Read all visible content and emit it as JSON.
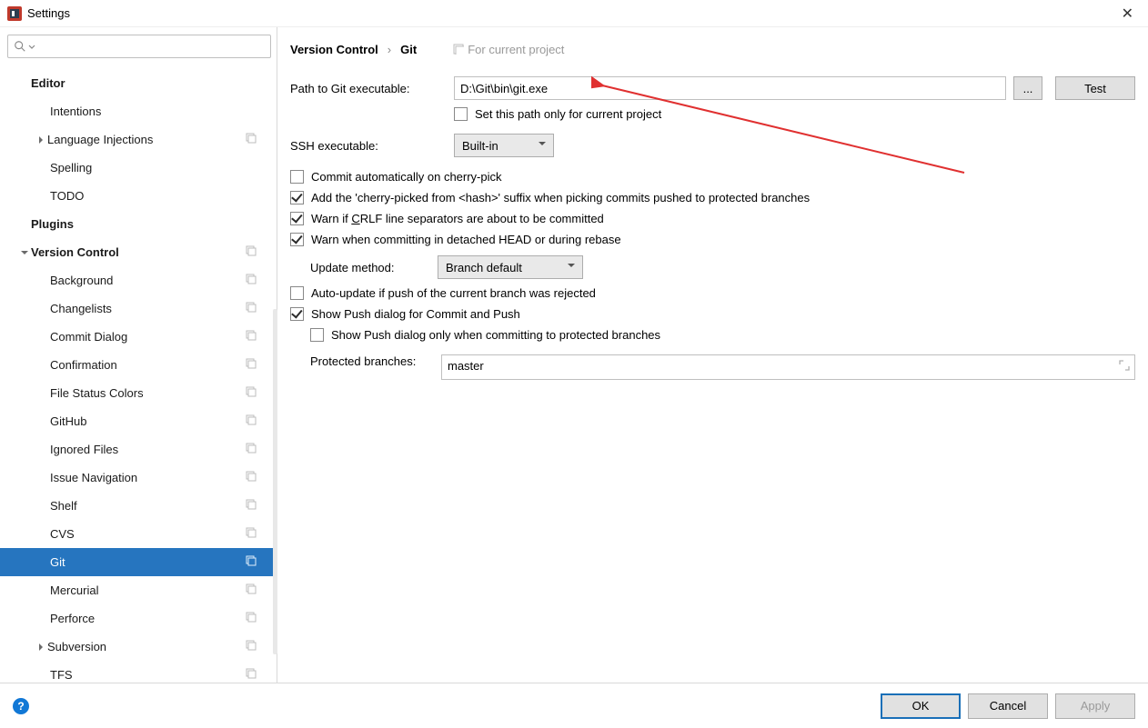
{
  "window": {
    "title": "Settings"
  },
  "breadcrumb": {
    "parent": "Version Control",
    "current": "Git",
    "hint": "For current project"
  },
  "sidebar": {
    "items": [
      {
        "label": "Editor",
        "bold": true,
        "depth": 0,
        "arrow": "",
        "proj": false
      },
      {
        "label": "Intentions",
        "bold": false,
        "depth": 2,
        "arrow": "",
        "proj": false
      },
      {
        "label": "Language Injections",
        "bold": false,
        "depth": 1,
        "arrow": ">",
        "proj": true
      },
      {
        "label": "Spelling",
        "bold": false,
        "depth": 2,
        "arrow": "",
        "proj": false
      },
      {
        "label": "TODO",
        "bold": false,
        "depth": 2,
        "arrow": "",
        "proj": false
      },
      {
        "label": "Plugins",
        "bold": true,
        "depth": 0,
        "arrow": "",
        "proj": false
      },
      {
        "label": "Version Control",
        "bold": true,
        "depth": 0,
        "arrow": "v",
        "proj": true
      },
      {
        "label": "Background",
        "bold": false,
        "depth": 2,
        "arrow": "",
        "proj": true
      },
      {
        "label": "Changelists",
        "bold": false,
        "depth": 2,
        "arrow": "",
        "proj": true
      },
      {
        "label": "Commit Dialog",
        "bold": false,
        "depth": 2,
        "arrow": "",
        "proj": true
      },
      {
        "label": "Confirmation",
        "bold": false,
        "depth": 2,
        "arrow": "",
        "proj": true
      },
      {
        "label": "File Status Colors",
        "bold": false,
        "depth": 2,
        "arrow": "",
        "proj": true
      },
      {
        "label": "GitHub",
        "bold": false,
        "depth": 2,
        "arrow": "",
        "proj": true
      },
      {
        "label": "Ignored Files",
        "bold": false,
        "depth": 2,
        "arrow": "",
        "proj": true
      },
      {
        "label": "Issue Navigation",
        "bold": false,
        "depth": 2,
        "arrow": "",
        "proj": true
      },
      {
        "label": "Shelf",
        "bold": false,
        "depth": 2,
        "arrow": "",
        "proj": true
      },
      {
        "label": "CVS",
        "bold": false,
        "depth": 2,
        "arrow": "",
        "proj": true
      },
      {
        "label": "Git",
        "bold": false,
        "depth": 2,
        "arrow": "",
        "proj": true,
        "selected": true
      },
      {
        "label": "Mercurial",
        "bold": false,
        "depth": 2,
        "arrow": "",
        "proj": true
      },
      {
        "label": "Perforce",
        "bold": false,
        "depth": 2,
        "arrow": "",
        "proj": true
      },
      {
        "label": "Subversion",
        "bold": false,
        "depth": 1,
        "arrow": ">",
        "proj": true
      },
      {
        "label": "TFS",
        "bold": false,
        "depth": 2,
        "arrow": "",
        "proj": true
      }
    ]
  },
  "form": {
    "path_label": "Path to Git executable:",
    "path_value": "D:\\Git\\bin\\git.exe",
    "browse": "...",
    "test": "Test",
    "set_path_project": "Set this path only for current project",
    "ssh_label": "SSH executable:",
    "ssh_value": "Built-in",
    "commit_cherry": "Commit automatically on cherry-pick",
    "add_suffix": "Add the 'cherry-picked from <hash>' suffix when picking commits pushed to protected branches",
    "warn_crlf_pre": "Warn if ",
    "warn_crlf_u": "C",
    "warn_crlf_post": "RLF line separators are about to be committed",
    "warn_detached": "Warn when committing in detached HEAD or during rebase",
    "update_label": "Update method:",
    "update_value": "Branch default",
    "auto_update": "Auto-update if push of the current branch was rejected",
    "show_push": "Show Push dialog for Commit and Push",
    "show_push_protected": "Show Push dialog only when committing to protected branches",
    "protected_label": "Protected branches:",
    "protected_value": "master"
  },
  "footer": {
    "ok": "OK",
    "cancel": "Cancel",
    "apply": "Apply"
  }
}
